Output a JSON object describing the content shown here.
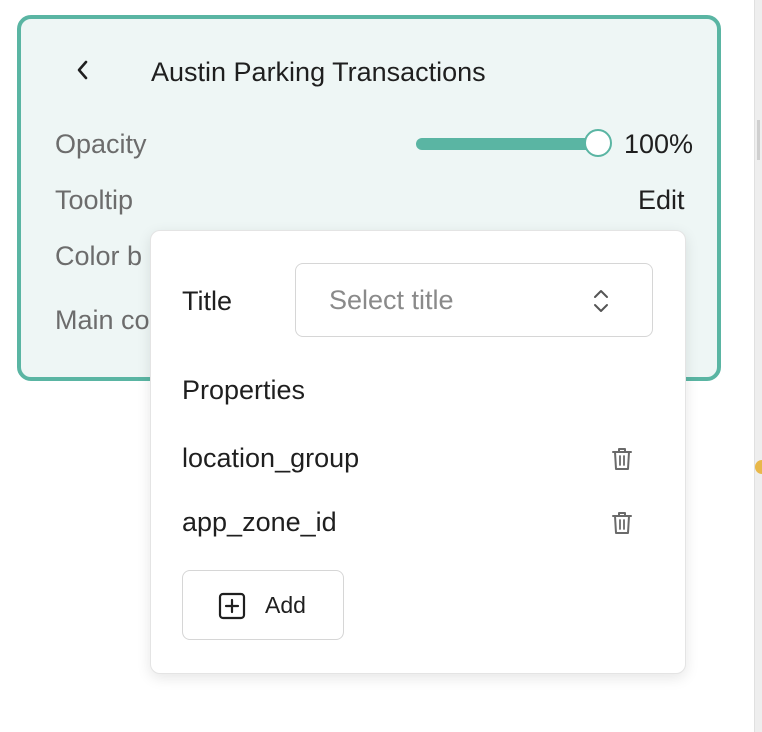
{
  "panel": {
    "title": "Austin Parking Transactions",
    "accent_color": "#5ab5a3",
    "rows": {
      "opacity_label": "Opacity",
      "opacity_value": "100%",
      "opacity_level": 1.0,
      "tooltip_label": "Tooltip",
      "tooltip_action": "Edit",
      "color_label_partial": "Color b",
      "main_label_partial": "Main co"
    }
  },
  "tooltip_popover": {
    "title_label": "Title",
    "title_select": {
      "placeholder": "Select title",
      "selected": ""
    },
    "properties_heading": "Properties",
    "properties": [
      {
        "name": "location_group"
      },
      {
        "name": "app_zone_id"
      }
    ],
    "add_label": "Add"
  },
  "icons": {
    "back": "chevron-left-icon",
    "select": "up-down-chevron-icon",
    "delete": "trash-icon",
    "add": "plus-square-icon"
  }
}
